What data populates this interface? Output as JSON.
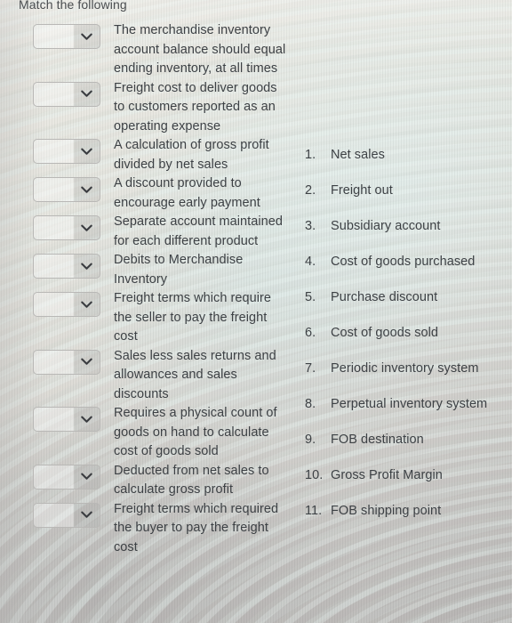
{
  "page": {
    "title": "Match the following"
  },
  "dropdown": {
    "value": "",
    "placeholder": "",
    "icon": "chevron-down-icon"
  },
  "match_items": [
    {
      "prompt": "The merchandise inventory account balance should equal ending inventory, at all times",
      "selected": ""
    },
    {
      "prompt": "Freight cost to deliver goods to customers reported as an operating expense",
      "selected": ""
    },
    {
      "prompt": "A calculation of gross profit divided by net sales",
      "selected": ""
    },
    {
      "prompt": "A discount provided to encourage early payment",
      "selected": ""
    },
    {
      "prompt": "Separate account maintained for each different product",
      "selected": ""
    },
    {
      "prompt": "Debits to Merchandise Inventory",
      "selected": ""
    },
    {
      "prompt": "Freight terms which require the seller to pay the freight cost",
      "selected": ""
    },
    {
      "prompt": "Sales less sales returns and allowances and sales discounts",
      "selected": ""
    },
    {
      "prompt": "Requires a physical count of goods on hand to calculate cost of goods sold",
      "selected": ""
    },
    {
      "prompt": "Deducted from net sales to calculate gross profit",
      "selected": ""
    },
    {
      "prompt": "Freight terms which required the buyer to pay the freight cost",
      "selected": ""
    }
  ],
  "options": [
    {
      "number": "1.",
      "label": "Net sales"
    },
    {
      "number": "2.",
      "label": "Freight out"
    },
    {
      "number": "3.",
      "label": "Subsidiary account"
    },
    {
      "number": "4.",
      "label": "Cost of goods purchased"
    },
    {
      "number": "5.",
      "label": "Purchase discount"
    },
    {
      "number": "6.",
      "label": "Cost of goods sold"
    },
    {
      "number": "7.",
      "label": "Periodic inventory system"
    },
    {
      "number": "8.",
      "label": "Perpetual inventory system"
    },
    {
      "number": "9.",
      "label": "FOB destination"
    },
    {
      "number": "10.",
      "label": "Gross Profit Margin"
    },
    {
      "number": "11.",
      "label": "FOB shipping point"
    }
  ],
  "colors": {
    "text": "#3d4145",
    "title": "#4a4d50",
    "dropdown_border": "#b9b8b6",
    "background_light": "#eceae4",
    "background_dark": "#b7b4b3"
  }
}
